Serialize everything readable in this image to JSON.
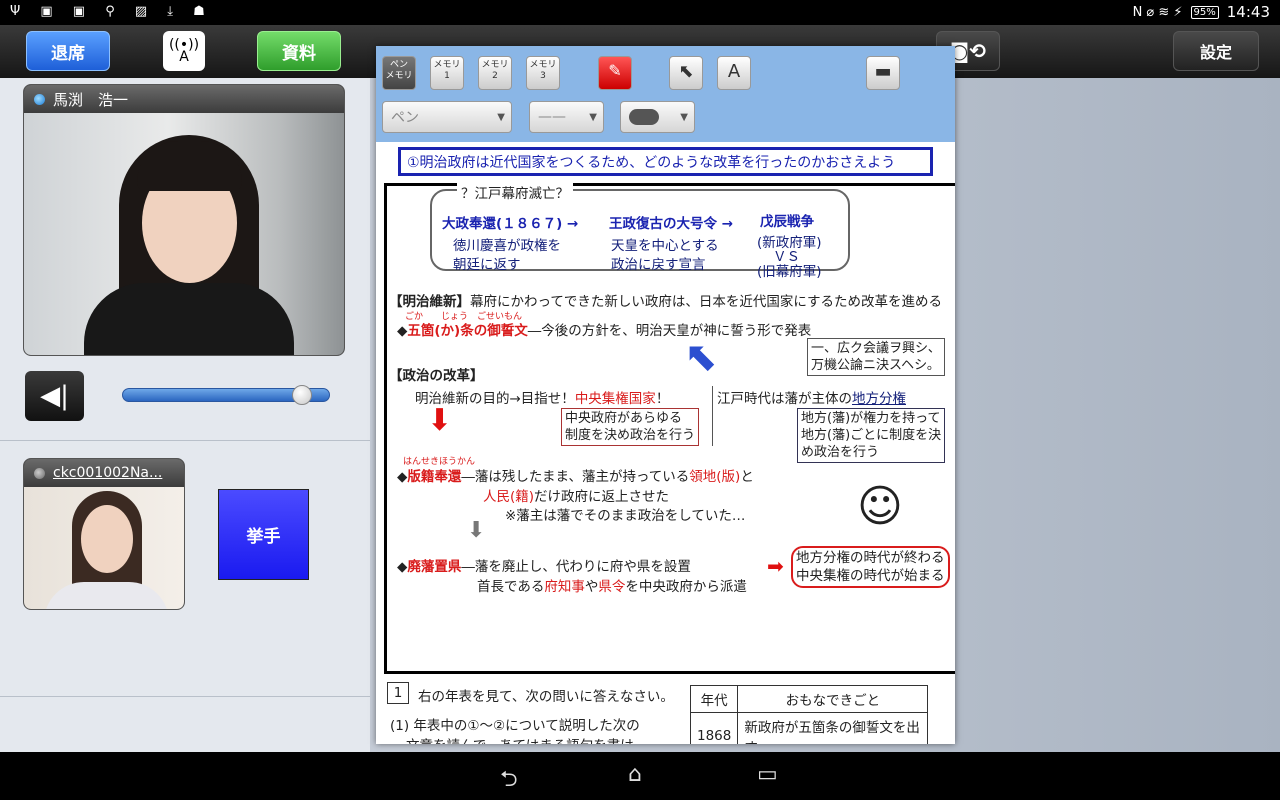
{
  "status": {
    "left_icons": "Ψ ▣ ▣ ⚲ ▨ ⤓ ☗",
    "right_icons": "N ⌀ ≋ ⚡",
    "battery": "95%",
    "time": "14:43"
  },
  "toolbar": {
    "exit_label": "退席",
    "antenna_label": "A",
    "docs_label": "資料",
    "camera_icon": "camera-switch-icon",
    "settings_label": "設定"
  },
  "participants": [
    {
      "name": "馬渕　浩一"
    },
    {
      "name": "ckc001002Na..."
    }
  ],
  "raise_hand_label": "挙手",
  "volume_level": 0.86,
  "doc_toolbar": {
    "tools": [
      {
        "label": "ペン\nメモリ"
      },
      {
        "label": "メモリ\n1"
      },
      {
        "label": "メモリ\n2"
      },
      {
        "label": "メモリ\n3"
      }
    ],
    "pen_style": "ペン",
    "line": "——"
  },
  "doc": {
    "objective": "①明治政府は近代国家をつくるため、どのような改革を行ったのかおさえよう",
    "timeline_title": "？江戸幕府滅亡？",
    "t1": "大政奉還(１８６７) →",
    "t1a": "徳川慶喜が政権を",
    "t1b": "朝廷に返す",
    "t2": "王政復古の大号令 →",
    "t2a": "天皇を中心とする",
    "t2b": "政治に戻す宣言",
    "t3": "戊辰戦争",
    "t3a": "(新政府軍)",
    "t3b": "ＶＳ",
    "t3c": "(旧幕府軍)",
    "meiji_head": "【明治維新】",
    "meiji_text": "幕府にかわってできた新しい政府は、日本を近代国家にするため改革を進める",
    "gokajo_ruby": "ごか　　じょう　ごせいもん",
    "gokajo": "五箇(か)条の御誓文",
    "gokajo_text": "―今後の方針を、明治天皇が神に誓う形で発表",
    "quote1": "一、広ク会議ヲ興シ、",
    "quote2": "万機公論ニ決スヘシ。",
    "reform_head": "【政治の改革】",
    "goal_a": "明治維新の目的→目指せ！",
    "goal_b": "中央集権国家",
    "goal_c": "！",
    "central1": "中央政府があらゆる",
    "central2": "制度を決め政治を行う",
    "edo_a": "江戸時代は藩が主体の",
    "edo_b": "地方分権",
    "local1": "地方(藩)が権力を持って",
    "local2": "地方(藩)ごとに制度を決",
    "local3": "め政治を行う",
    "hanseki_ruby": "はんせきほうかん",
    "hanseki": "版籍奉還",
    "hanseki_t1": "―藩は残したまま、藩主が持っている",
    "hanseki_t2": "領地(版)",
    "hanseki_t3": "と",
    "hanseki_t4": "人民(籍)",
    "hanseki_t5": "だけ政府に返上させた",
    "hanseki_note": "※藩主は藩でそのまま政治をしていた…",
    "haihan": "廃藩置県",
    "haihan_t1": "―藩を廃止し、代わりに府や県を設置",
    "haihan_t2": "首長である",
    "haihan_t3": "府知事",
    "haihan_t4": "や",
    "haihan_t5": "県令",
    "haihan_t6": "を中央政府から派遣",
    "end1": "地方分権の時代が終わる",
    "end2": "中央集権の時代が始まる",
    "q_num": "1",
    "q_text": "右の年表を見て、次の問いに答えなさい。",
    "q1": "(1) 年表中の①～②について説明した次の",
    "q1b": "文章を読んで、あてはまる語句を書け",
    "table_h1": "年代",
    "table_h2": "おもなできごと",
    "table_r1c1": "1868",
    "table_r1c2": "新政府が五箇条の御誓文を出す"
  },
  "nav": {
    "back": "⮌",
    "home": "⌂",
    "recent": "▭"
  }
}
